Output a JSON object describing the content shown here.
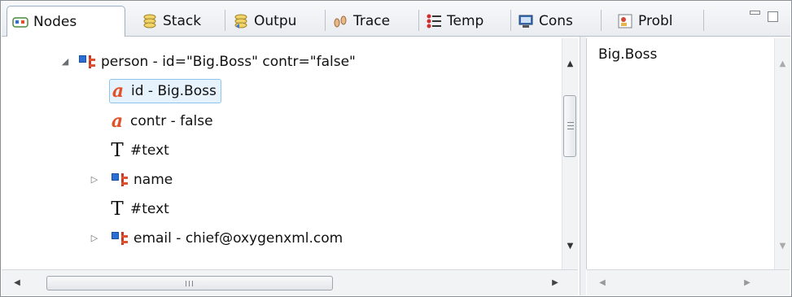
{
  "tabs": [
    {
      "label": "Nodes",
      "icon": "nodes-icon",
      "active": true
    },
    {
      "label": "Stack",
      "icon": "stack-icon"
    },
    {
      "label": "Outpu",
      "icon": "output-icon"
    },
    {
      "label": "Trace",
      "icon": "trace-icon"
    },
    {
      "label": "Temp",
      "icon": "templates-icon"
    },
    {
      "label": "Cons",
      "icon": "console-icon"
    },
    {
      "label": "Probl",
      "icon": "problems-icon"
    }
  ],
  "window_controls": {
    "minimize_icon": "minimize-icon",
    "maximize_icon": "maximize-icon"
  },
  "tree": [
    {
      "text": "person - id=\"Big.Boss\" contr=\"false\"",
      "type": "element",
      "expander": "expanded"
    },
    {
      "text": "id - Big.Boss",
      "type": "attribute",
      "selected": true
    },
    {
      "text": "contr - false",
      "type": "attribute"
    },
    {
      "text": "#text",
      "type": "text"
    },
    {
      "text": "name",
      "type": "element",
      "expander": "collapsed"
    },
    {
      "text": "#text",
      "type": "text"
    },
    {
      "text": "email - chief@oxygenxml.com",
      "type": "element",
      "expander": "collapsed"
    }
  ],
  "value_panel": {
    "text": "Big.Boss"
  },
  "icons": {
    "attribute_glyph": "a",
    "text_glyph": "T"
  },
  "colors": {
    "selection_bg": "#e6f2fc",
    "selection_border": "#8cc4ee",
    "attr_icon": "#e0532a",
    "elem_icon_blue": "#2b6fd6",
    "elem_icon_red": "#c03a2b"
  }
}
